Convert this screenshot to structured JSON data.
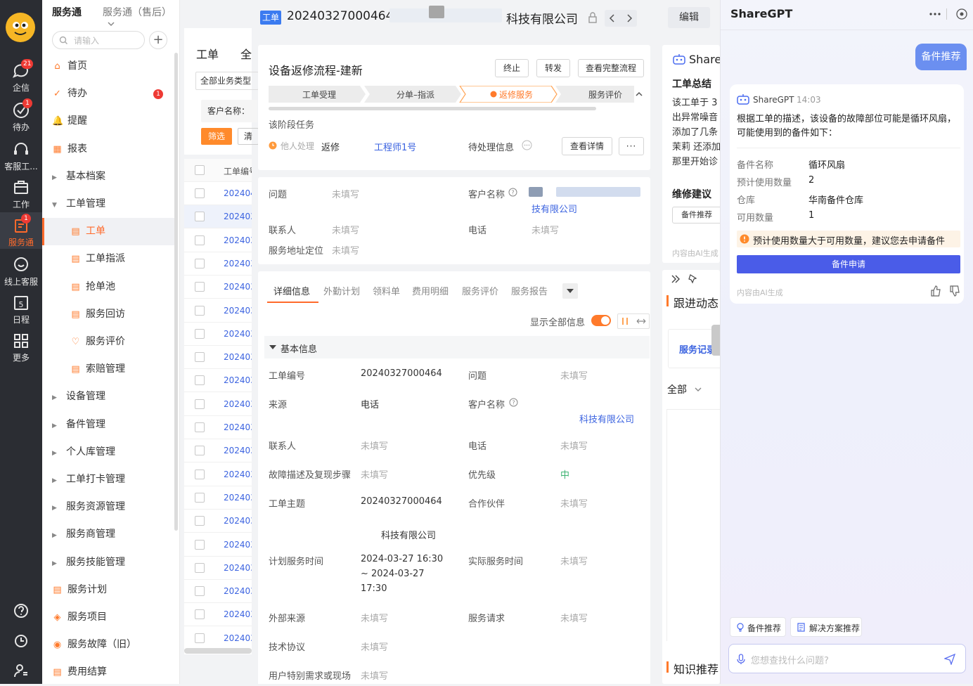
{
  "rail": {
    "items": [
      {
        "label": "企信",
        "badge": "21",
        "icon": "chat-bubble-icon"
      },
      {
        "label": "待办",
        "badge": "1",
        "icon": "check-circle-icon"
      },
      {
        "label": "客服工...",
        "badge": "",
        "icon": "headset-icon"
      },
      {
        "label": "工作",
        "badge": "",
        "icon": "briefcase-icon"
      },
      {
        "label": "服务通",
        "badge": "1",
        "icon": "service-icon"
      },
      {
        "label": "线上客服",
        "badge": "",
        "icon": "online-service-icon"
      },
      {
        "label": "日程",
        "badge": "",
        "icon": "calendar-icon",
        "day": "5"
      },
      {
        "label": "更多",
        "badge": "",
        "icon": "grid-icon"
      }
    ]
  },
  "nav": {
    "app_title": "服务通",
    "app_selector": "服务通（售后）",
    "search_placeholder": "请输入",
    "items": [
      {
        "label": "首页",
        "icon": "⌂"
      },
      {
        "label": "待办",
        "icon": "✓",
        "badge": "1"
      },
      {
        "label": "提醒",
        "icon": "🔔"
      },
      {
        "label": "报表",
        "icon": "▦"
      },
      {
        "label": "基本档案",
        "caret": "▶"
      },
      {
        "label": "工单管理",
        "caret": "▼"
      },
      {
        "label": "工单",
        "icon": "▤",
        "sub": true,
        "active": true
      },
      {
        "label": "工单指派",
        "icon": "▤",
        "sub": true
      },
      {
        "label": "抢单池",
        "icon": "▤",
        "sub": true
      },
      {
        "label": "服务回访",
        "icon": "▤",
        "sub": true
      },
      {
        "label": "服务评价",
        "icon": "♡",
        "sub": true
      },
      {
        "label": "索赔管理",
        "icon": "▤",
        "sub": true
      },
      {
        "label": "设备管理",
        "caret": "▶"
      },
      {
        "label": "备件管理",
        "caret": "▶"
      },
      {
        "label": "个人库管理",
        "caret": "▶"
      },
      {
        "label": "工单打卡管理",
        "caret": "▶"
      },
      {
        "label": "服务资源管理",
        "caret": "▶"
      },
      {
        "label": "服务商管理",
        "caret": "▶"
      },
      {
        "label": "服务技能管理",
        "caret": "▶"
      },
      {
        "label": "服务计划",
        "icon": "▤"
      },
      {
        "label": "服务项目",
        "icon": "◈"
      },
      {
        "label": "服务故障（旧）",
        "icon": "◉"
      },
      {
        "label": "费用结算",
        "icon": "▤"
      }
    ]
  },
  "list": {
    "title": "工单",
    "title2": "全",
    "filter_type": "全部业务类型",
    "customer_label": "客户名称：",
    "filter_btn": "筛选",
    "clear_btn": "清",
    "col_header": "工单编号",
    "rows": [
      "202404",
      "202403",
      "202403",
      "202403",
      "202403",
      "202403",
      "202403",
      "202403",
      "202403",
      "202403",
      "202403",
      "202403",
      "202403",
      "202403",
      "202403",
      "202403",
      "202403",
      "202403",
      "202403",
      "202403"
    ]
  },
  "ticket": {
    "tag": "工单",
    "number": "20240327000464",
    "company_suffix": "科技有限公司",
    "edit_label": "编辑",
    "flow_title": "设备返修流程-建新",
    "btn_stop": "终止",
    "btn_forward": "转发",
    "btn_full_flow": "查看完整流程",
    "steps": [
      "工单受理",
      "分单–指派",
      "返修服务",
      "服务评价"
    ],
    "stage_task_label": "该阶段任务",
    "other_handling": "他人处理",
    "task_name": "返修",
    "engineer": "工程师1号",
    "pending_label": "待处理信息",
    "view_detail": "查看详情",
    "more_dots": "···"
  },
  "quick_info": {
    "issue_label": "问题",
    "issue_val": "未填写",
    "customer_label": "客户名称",
    "customer_val": "技有限公司",
    "contact_label": "联系人",
    "contact_val": "未填写",
    "phone_label": "电话",
    "phone_val": "未填写",
    "address_label": "服务地址定位",
    "address_val": "未填写"
  },
  "detail": {
    "tabs": [
      "详细信息",
      "外勤计划",
      "领料单",
      "费用明细",
      "服务评价",
      "服务报告"
    ],
    "show_all_label": "显示全部信息",
    "section_title": "基本信息",
    "fields_left": [
      {
        "label": "工单编号",
        "value": "20240327000464",
        "filled": true
      },
      {
        "label": "来源",
        "value": "电话",
        "filled": true
      },
      {
        "label": "联系人",
        "value": "未填写",
        "filled": false
      },
      {
        "label": "故障描述及复现步骤",
        "value": "未填写",
        "filled": false
      },
      {
        "label": "工单主题",
        "value": "20240327000464",
        "filled": true,
        "extra": "科技有限公司"
      },
      {
        "label": "计划服务时间",
        "value": "2024-03-27 16:30",
        "filled": true,
        "extra1": "~ 2024-03-27",
        "extra2": "17:30"
      },
      {
        "label": "外部来源",
        "value": "未填写",
        "filled": false
      },
      {
        "label": "技术协议",
        "value": "未填写",
        "filled": false
      },
      {
        "label": "用户特别需求或现场",
        "value": "未填写",
        "filled": false
      }
    ],
    "fields_right": [
      {
        "label": "问题",
        "value": "未填写",
        "filled": false
      },
      {
        "label": "客户名称",
        "value": "科技有限公司",
        "link": true
      },
      {
        "label": "电话",
        "value": "未填写",
        "filled": false
      },
      {
        "label": "优先级",
        "value": "中",
        "priority": true
      },
      {
        "label": "合作伙伴",
        "value": "未填写",
        "filled": false
      },
      {
        "label": "实际服务时间",
        "value": "未填写",
        "filled": false
      },
      {
        "label": "服务请求",
        "value": "未填写",
        "filled": false
      }
    ]
  },
  "summary": {
    "brand": "Share",
    "title": "工单总结",
    "lines": [
      "该工单于 3",
      "出异常噪音",
      "添加了几条",
      "茉莉 还添加",
      "那里开始诊"
    ],
    "advice_title": "维修建议",
    "advice_btn": "备件推荐",
    "ai_note": "内容由AI生成",
    "follow_title": "跟进动态",
    "service_record": "服务记录",
    "filter_all": "全部",
    "knowledge_title": "知识推荐"
  },
  "chat": {
    "title": "ShareGPT",
    "user_msg": "备件推荐",
    "bot_name": "ShareGPT",
    "bot_time": "14:03",
    "bot_text": "根据工单的描述，该设备的故障部位可能是循环风扇，可能使用到的备件如下：",
    "parts": [
      {
        "label": "备件名称",
        "value": "循环风扇"
      },
      {
        "label": "预计使用数量",
        "value": "2"
      },
      {
        "label": "仓库",
        "value": "华南备件仓库"
      },
      {
        "label": "可用数量",
        "value": "1"
      }
    ],
    "warning": "预计使用数量大于可用数量，建议您去申请备件",
    "apply_btn": "备件申请",
    "ai_note": "内容由AI生成",
    "quick_btns": [
      "备件推荐",
      "解决方案推荐"
    ],
    "input_placeholder": "您想查找什么问题?"
  },
  "colors": {
    "accent": "#ff6a2b",
    "link": "#3b63e0",
    "primary_btn": "#4a5ce8",
    "chat_bubble": "#6b8ff0"
  }
}
